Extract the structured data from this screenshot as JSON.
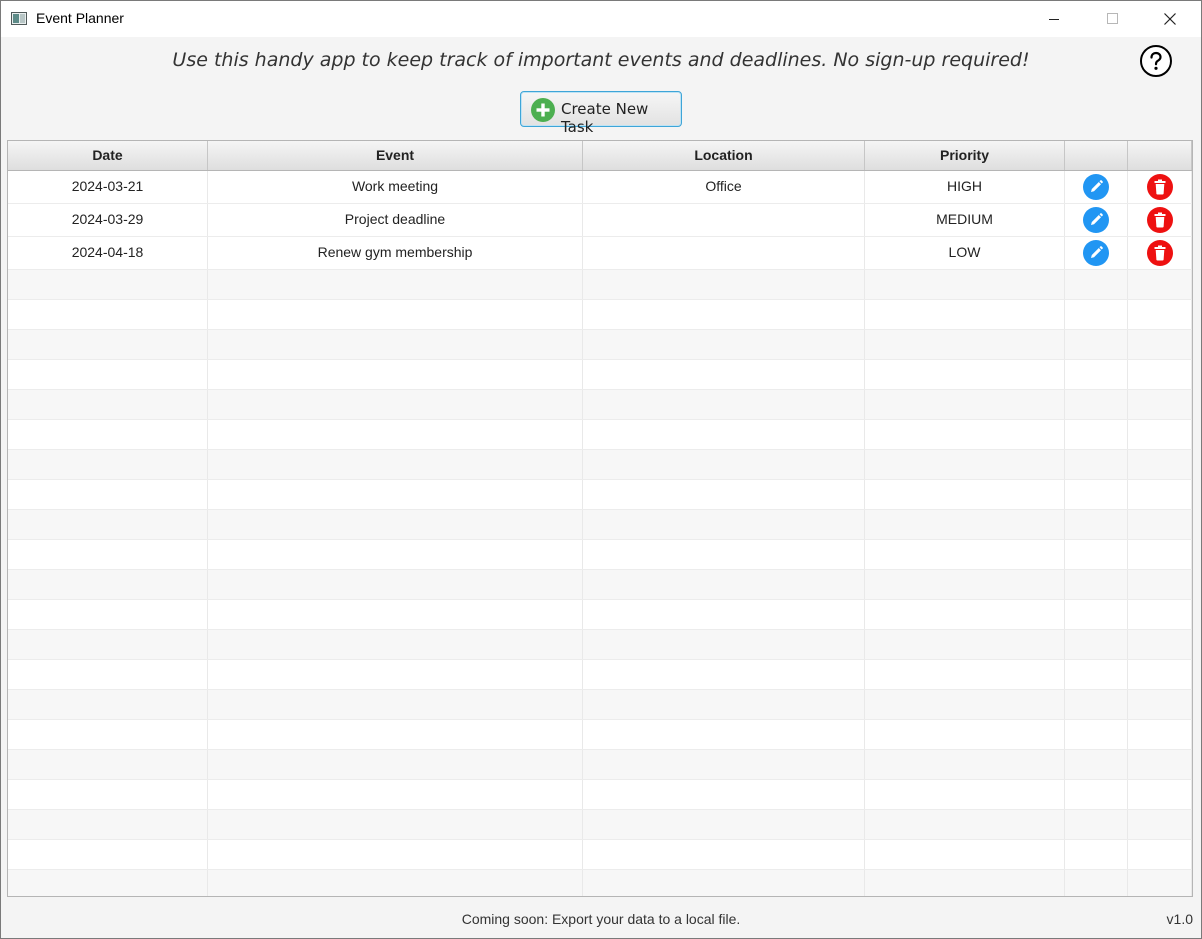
{
  "window": {
    "title": "Event Planner"
  },
  "header": {
    "tagline": "Use this handy app to keep track of important events and deadlines.  No sign-up required!"
  },
  "toolbar": {
    "create_label": "Create New Task"
  },
  "table": {
    "columns": [
      "Date",
      "Event",
      "Location",
      "Priority",
      "",
      ""
    ],
    "rows": [
      {
        "date": "2024-03-21",
        "event": "Work meeting",
        "location": "Office",
        "priority": "HIGH"
      },
      {
        "date": "2024-03-29",
        "event": "Project deadline",
        "location": "",
        "priority": "MEDIUM"
      },
      {
        "date": "2024-04-18",
        "event": "Renew gym membership",
        "location": "",
        "priority": "LOW"
      }
    ]
  },
  "footer": {
    "message": "Coming soon: Export your data to a local file.",
    "version": "v1.0"
  },
  "icons": {
    "app": "app-window-icon",
    "help": "help-circle-icon",
    "create": "plus-circle-icon",
    "edit": "pencil-icon",
    "delete": "trash-icon"
  },
  "colors": {
    "accent_blue": "#2196f3",
    "delete_red": "#ee1111",
    "create_green": "#4caf50",
    "button_focus_border": "#3ea5d8"
  }
}
